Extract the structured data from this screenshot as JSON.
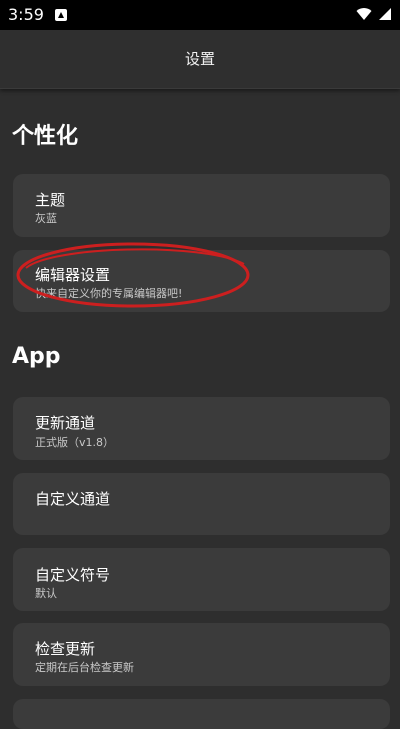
{
  "status_bar": {
    "time": "3:59"
  },
  "app_bar": {
    "title": "设置"
  },
  "sections": {
    "personalization": {
      "title": "个性化",
      "items": [
        {
          "title": "主题",
          "subtitle": "灰蓝"
        },
        {
          "title": "编辑器设置",
          "subtitle": "快来自定义你的专属编辑器吧!"
        }
      ]
    },
    "app": {
      "title": "App",
      "items": [
        {
          "title": "更新通道",
          "subtitle": "正式版（v1.8）"
        },
        {
          "title": "自定义通道",
          "subtitle": ""
        },
        {
          "title": "自定义符号",
          "subtitle": "默认"
        },
        {
          "title": "检查更新",
          "subtitle": "定期在后台检查更新"
        }
      ]
    }
  },
  "colors": {
    "background": "#2e2e2e",
    "card": "#3b3b3b",
    "highlight_annotation": "#cc1f1f"
  },
  "icons": [
    "notification-icon",
    "wifi-icon",
    "cellular-signal-icon"
  ]
}
